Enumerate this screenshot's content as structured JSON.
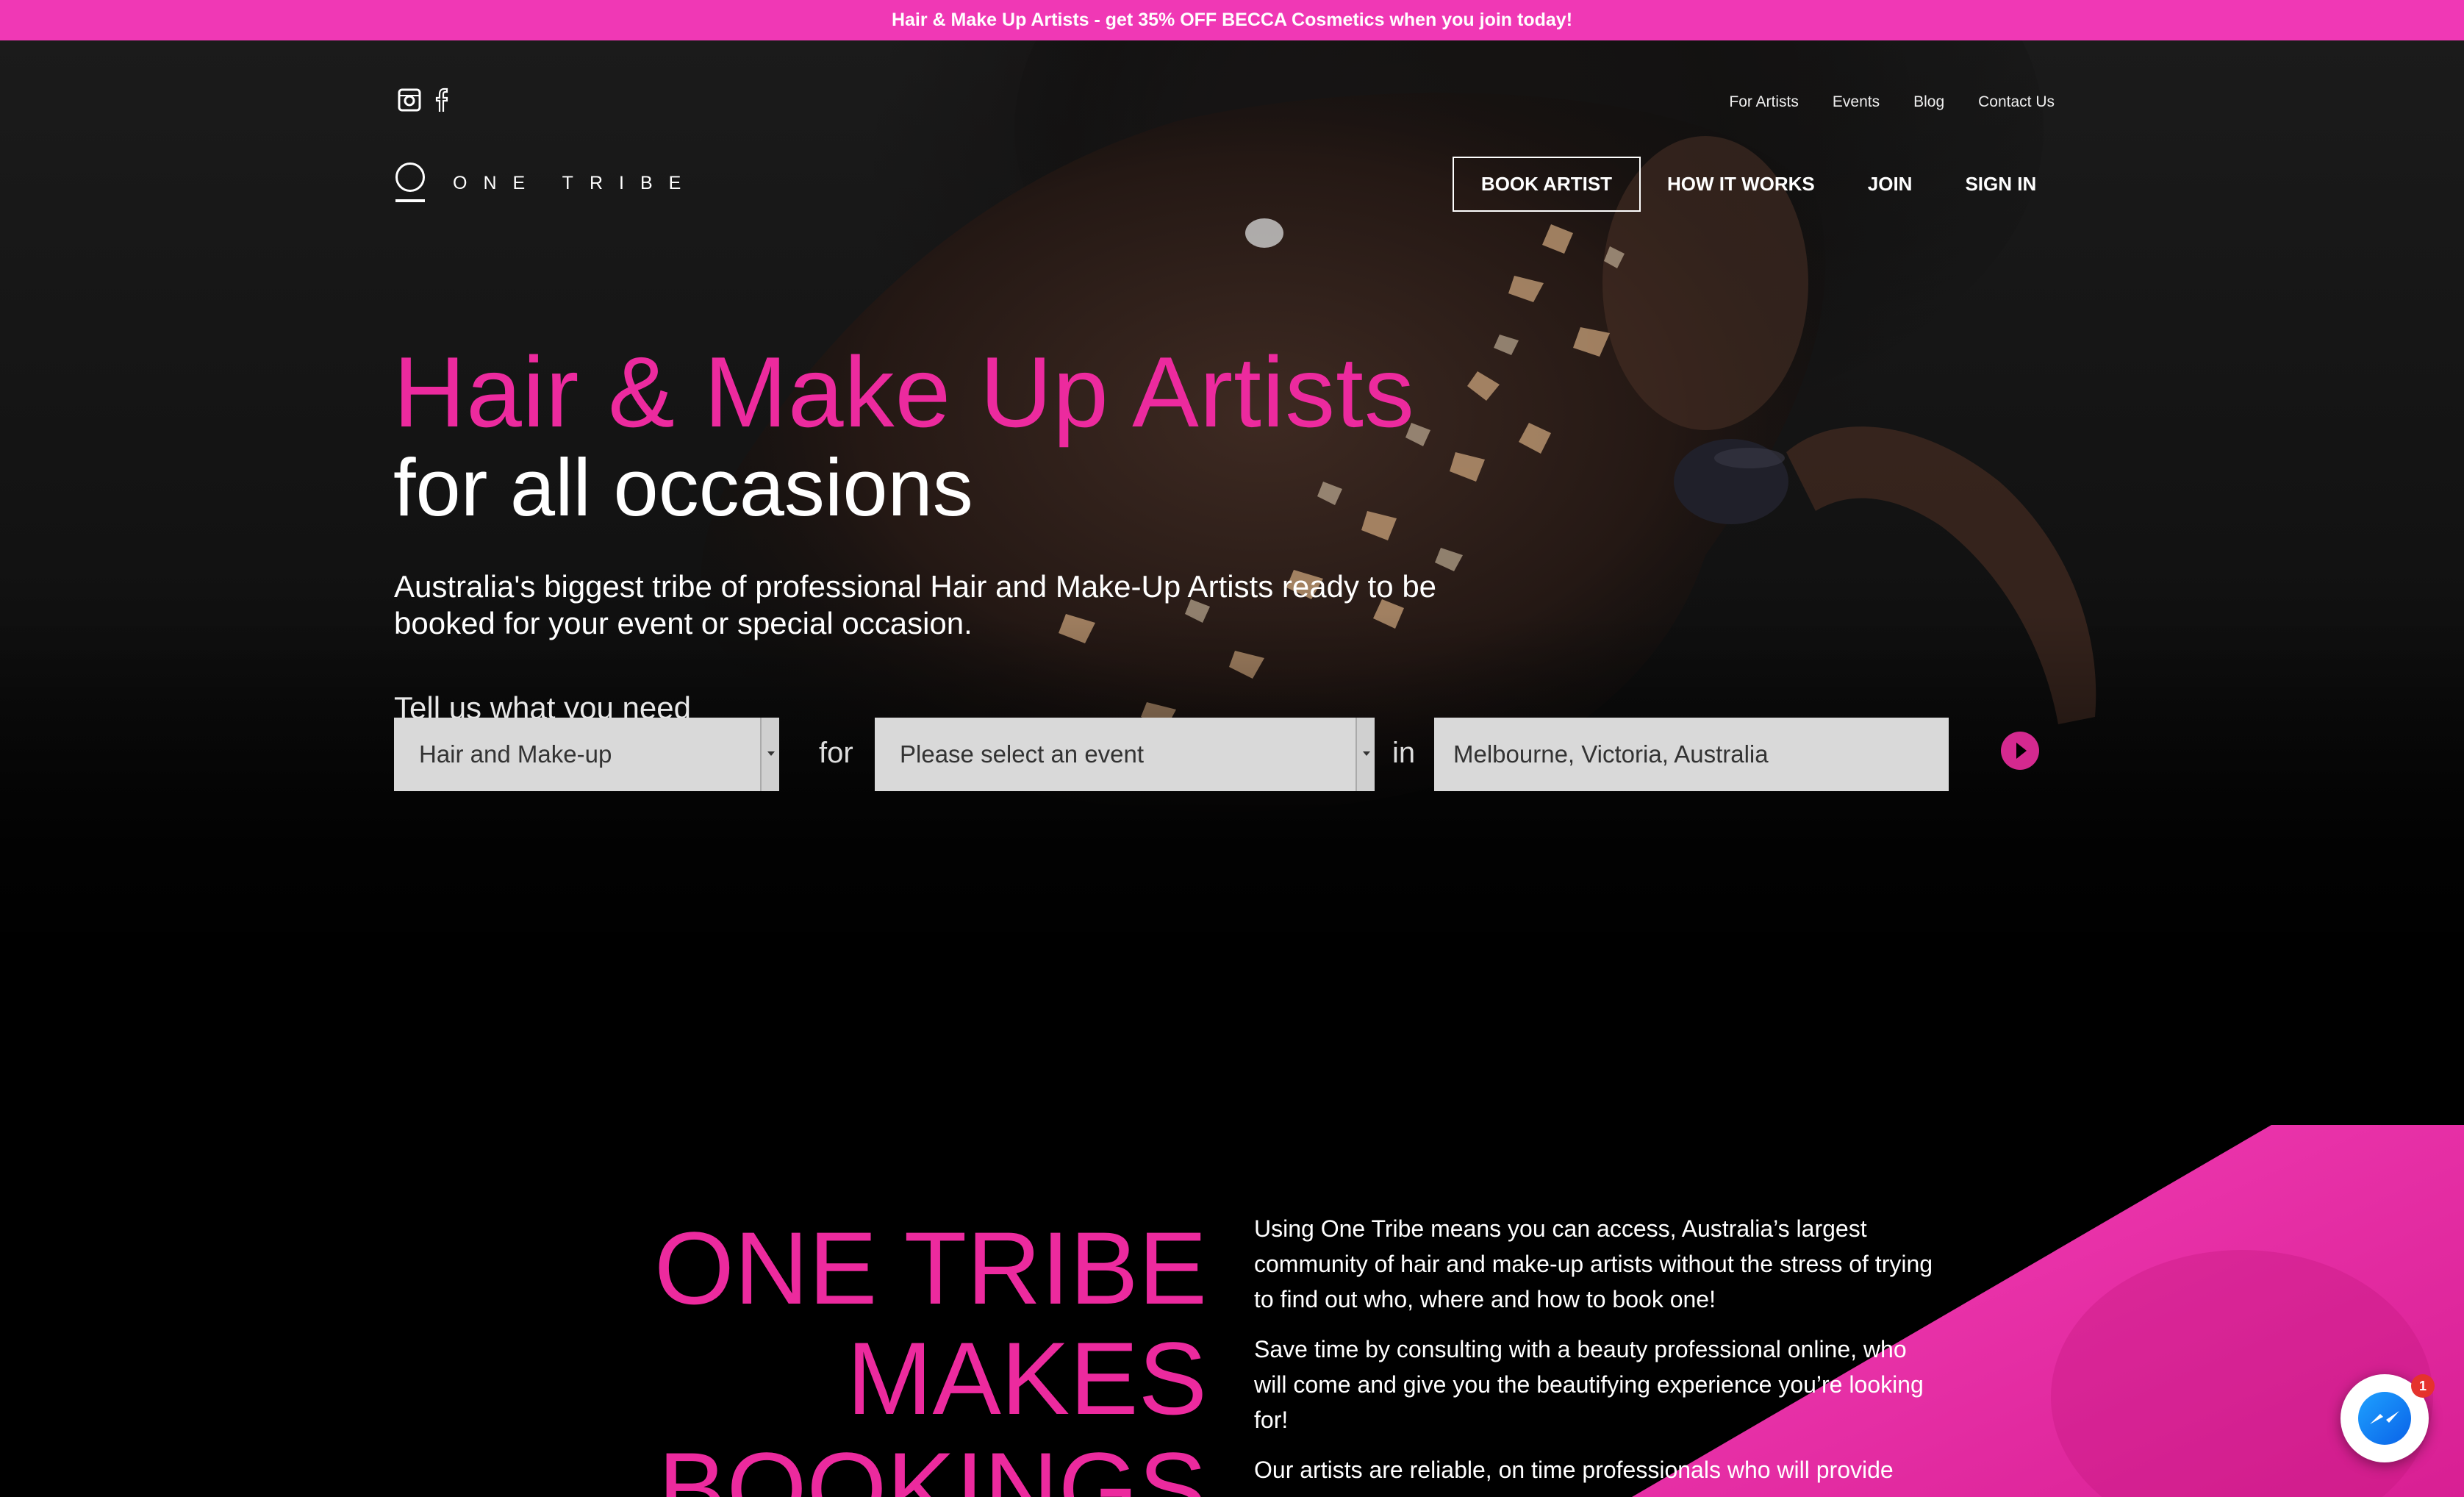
{
  "promo": {
    "text": "Hair & Make Up Artists - get 35% OFF BECCA Cosmetics when you join today!"
  },
  "social": {
    "icons": [
      "instagram-icon",
      "facebook-icon"
    ]
  },
  "util_nav": {
    "items": [
      "For Artists",
      "Events",
      "Blog",
      "Contact Us"
    ]
  },
  "brand": {
    "name": "ONE TRIBE"
  },
  "main_nav": {
    "book": "BOOK ARTIST",
    "how": "HOW IT WORKS",
    "join": "JOIN",
    "signin": "SIGN IN"
  },
  "hero": {
    "title": "Hair & Make Up Artists",
    "subtitle": "for all occasions",
    "description": "Australia's biggest tribe of professional Hair and Make-Up Artists ready to be booked for your event or special occasion.",
    "prompt": "Tell us what you need"
  },
  "search": {
    "service": "Hair and Make-up",
    "for_label": "for",
    "event": "Please select an event",
    "in_label": "in",
    "location": "Melbourne, Victoria, Australia"
  },
  "about": {
    "heading": [
      "ONE TRIBE",
      "MAKES",
      "BOOKINGS"
    ],
    "paragraphs": [
      "Using One Tribe means you can access, Australia’s largest community of hair and make-up artists without the stress of trying to find out who, where and how to book one!",
      "Save time by consulting with a beauty professional online, who will come and give you the beautifying experience you’re looking for!",
      "Our artists are reliable, on time professionals who will provide"
    ]
  },
  "messenger": {
    "badge": "1"
  },
  "colors": {
    "accent": "#ec2a9e",
    "promo_bg": "#f038b5",
    "go_button": "#d4298f"
  }
}
